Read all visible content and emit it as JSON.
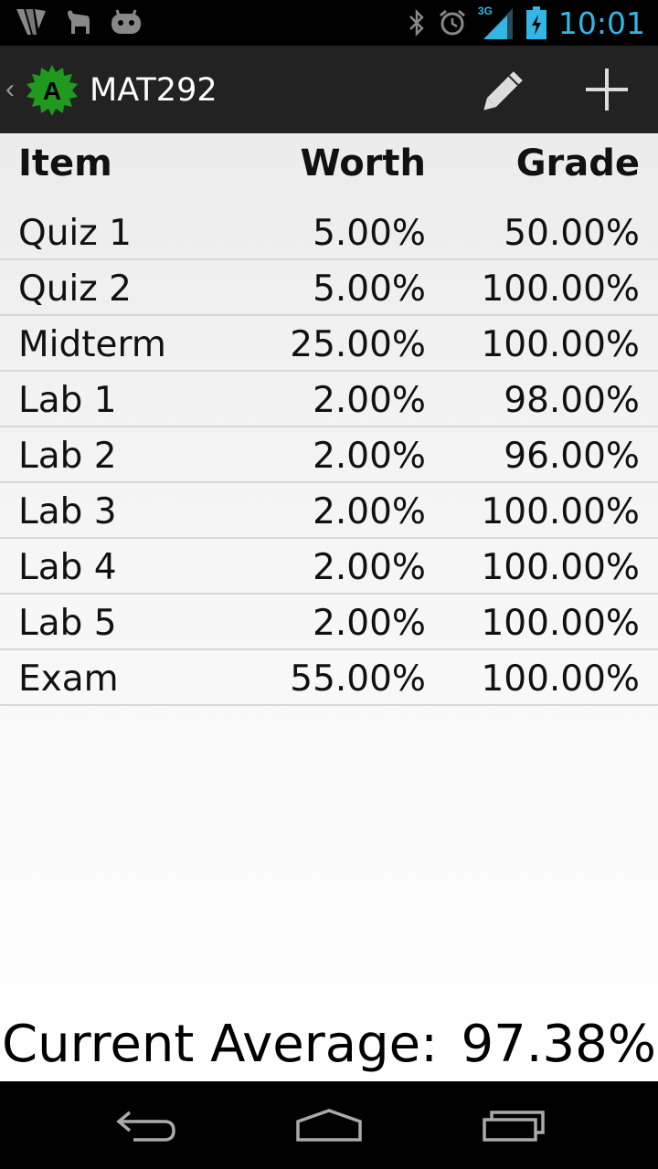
{
  "status_bar": {
    "time": "10:01",
    "network_type": "3G",
    "icons": [
      "notification-app-icon",
      "notification-animal-icon",
      "notification-android-icon",
      "bluetooth-icon",
      "alarm-icon",
      "signal-icon",
      "battery-charging-icon"
    ]
  },
  "action_bar": {
    "title": "MAT292",
    "app_icon_letter": "A",
    "actions": [
      "edit-icon",
      "add-icon"
    ]
  },
  "table": {
    "headers": {
      "item": "Item",
      "worth": "Worth",
      "grade": "Grade"
    },
    "rows": [
      {
        "item": "Quiz 1",
        "worth": "5.00%",
        "grade": "50.00%"
      },
      {
        "item": "Quiz 2",
        "worth": "5.00%",
        "grade": "100.00%"
      },
      {
        "item": "Midterm",
        "worth": "25.00%",
        "grade": "100.00%"
      },
      {
        "item": "Lab 1",
        "worth": "2.00%",
        "grade": "98.00%"
      },
      {
        "item": "Lab 2",
        "worth": "2.00%",
        "grade": "96.00%"
      },
      {
        "item": "Lab 3",
        "worth": "2.00%",
        "grade": "100.00%"
      },
      {
        "item": "Lab 4",
        "worth": "2.00%",
        "grade": "100.00%"
      },
      {
        "item": "Lab 5",
        "worth": "2.00%",
        "grade": "100.00%"
      },
      {
        "item": "Exam",
        "worth": "55.00%",
        "grade": "100.00%"
      }
    ]
  },
  "summary": {
    "label": "Current Average:",
    "value": "97.38%"
  },
  "colors": {
    "accent": "#33b5e5",
    "action_bar": "#222222",
    "app_icon": "#1f9a1f"
  }
}
